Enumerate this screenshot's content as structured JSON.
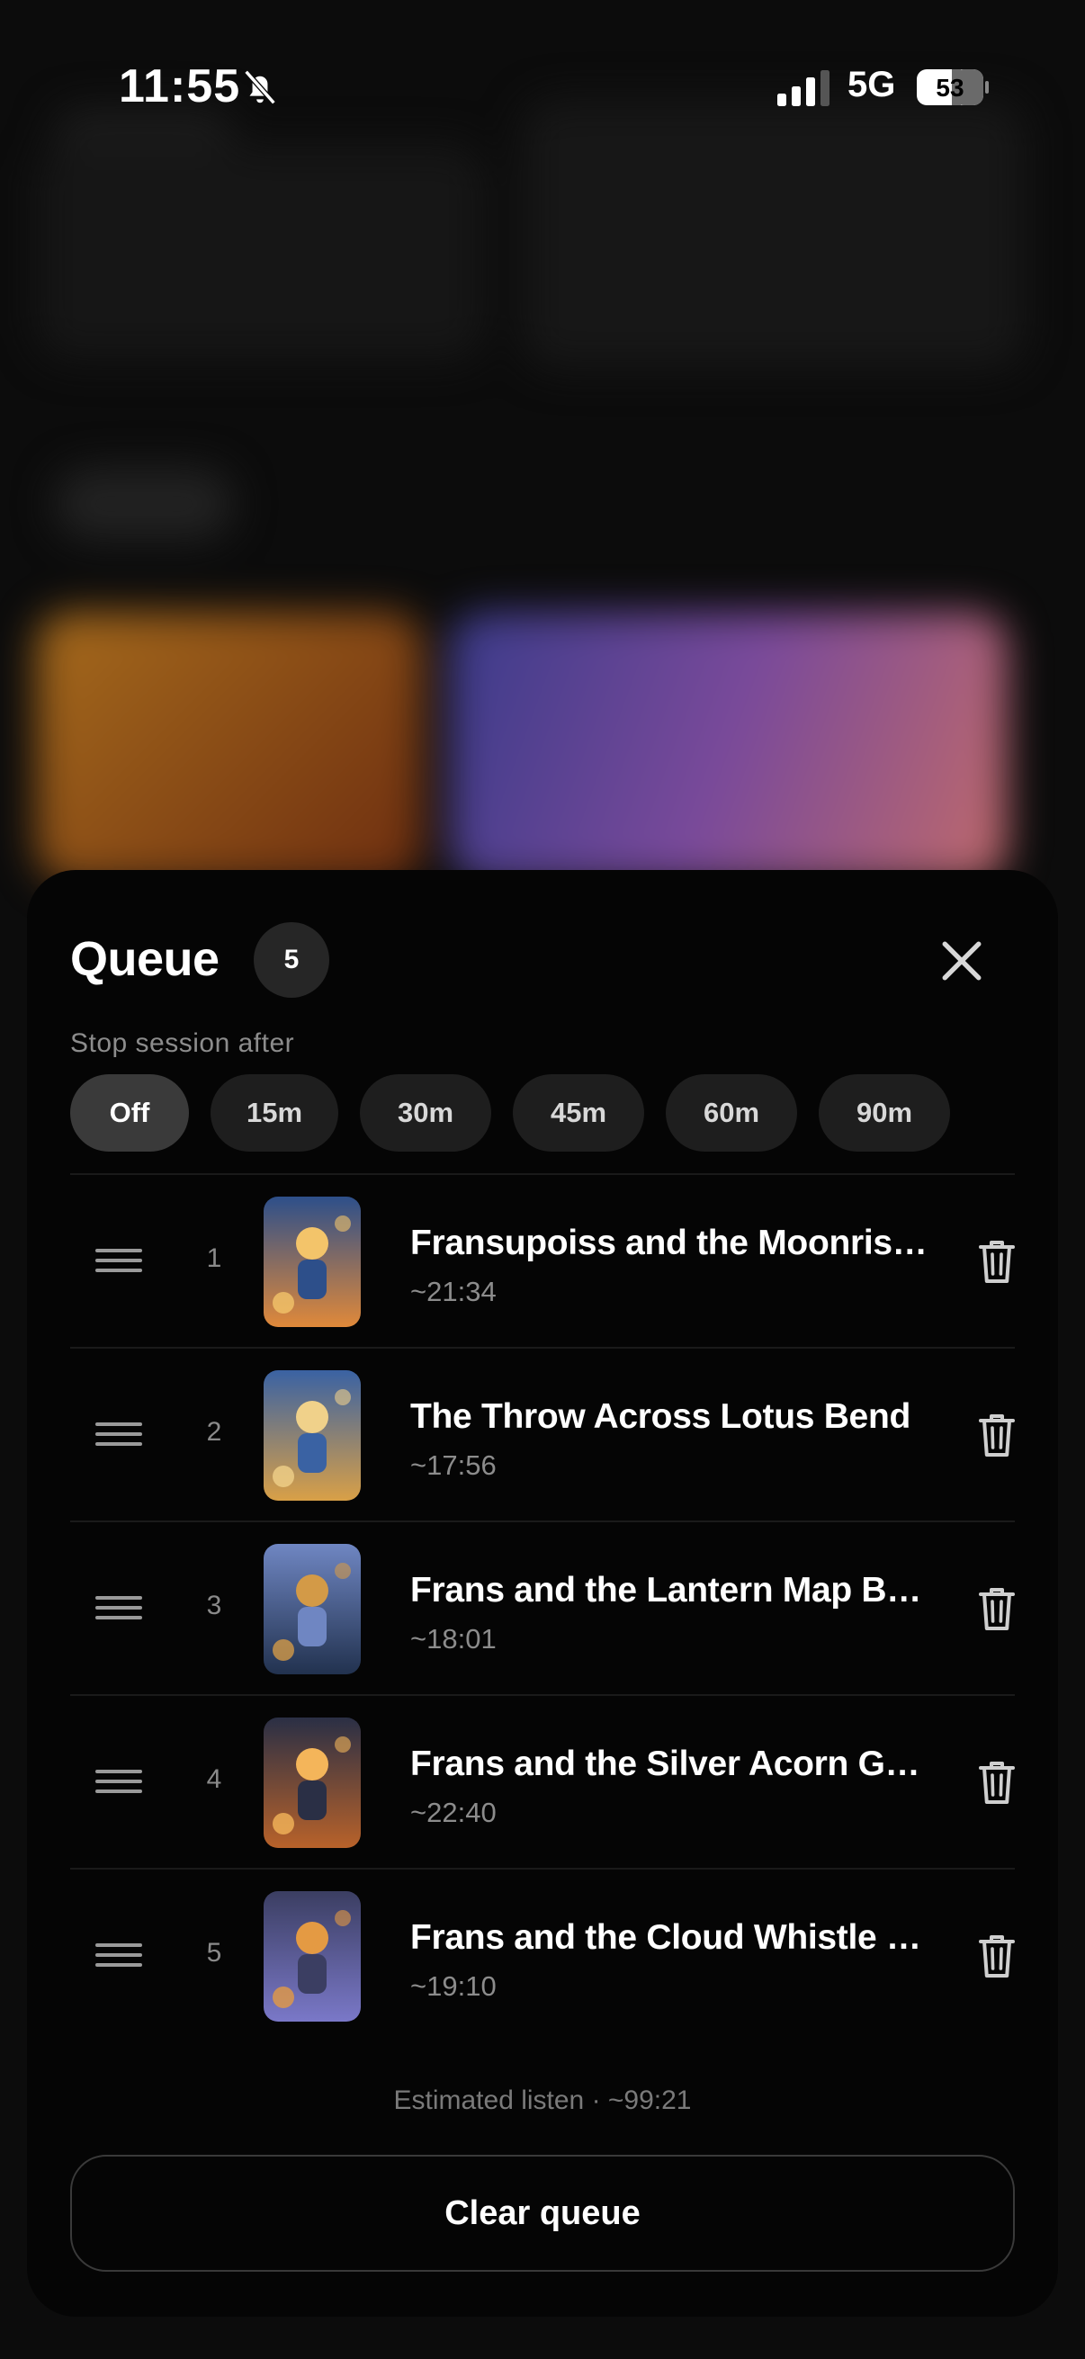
{
  "status_bar": {
    "time": "11:55",
    "network": "5G",
    "battery": "53",
    "icons": [
      "bell-slash-icon",
      "signal-icon",
      "battery-icon"
    ]
  },
  "queue": {
    "title": "Queue",
    "count": "5",
    "stop_label": "Stop session after",
    "chips": [
      "Off",
      "15m",
      "30m",
      "45m",
      "60m",
      "90m"
    ],
    "active_chip": "Off",
    "items": [
      {
        "index": "1",
        "title": "Fransupoiss and the Moonrise Tower",
        "duration": "~21:34",
        "colors": [
          "#e0893a",
          "#2d4f8a",
          "#f3c46a"
        ]
      },
      {
        "index": "2",
        "title": "The Throw Across Lotus Bend",
        "duration": "~17:56",
        "colors": [
          "#d9a047",
          "#3a62a3",
          "#f0d18a"
        ]
      },
      {
        "index": "3",
        "title": "Frans and the Lantern Map Beyond",
        "duration": "~18:01",
        "colors": [
          "#22324f",
          "#6f86c2",
          "#d39a47"
        ]
      },
      {
        "index": "4",
        "title": "Frans and the Silver Acorn Gate",
        "duration": "~22:40",
        "colors": [
          "#b8622a",
          "#2a2f45",
          "#f4b55a"
        ]
      },
      {
        "index": "5",
        "title": "Frans and the Cloud Whistle Tower",
        "duration": "~19:10",
        "colors": [
          "#7a78c8",
          "#3b3e62",
          "#e49a43"
        ]
      }
    ],
    "estimate": "Estimated listen · ~99:21",
    "clear_label": "Clear queue"
  }
}
